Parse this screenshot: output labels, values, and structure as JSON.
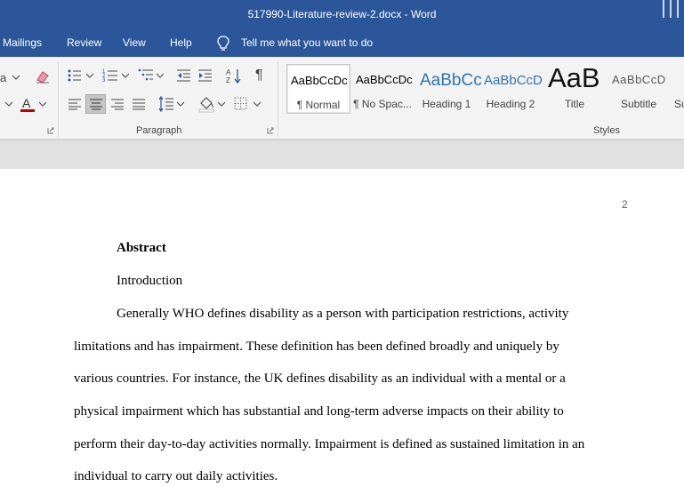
{
  "window": {
    "title": "517990-Literature-review-2.docx  -  Word"
  },
  "menu": {
    "tabs": [
      "Mailings",
      "Review",
      "View",
      "Help"
    ],
    "tell_me": "Tell me what you want to do"
  },
  "ribbon": {
    "groups": {
      "paragraph": "Paragraph",
      "styles": "Styles"
    },
    "styles": [
      {
        "preview": "AaBbCcDc",
        "name": "¶ Normal"
      },
      {
        "preview": "AaBbCcDc",
        "name": "¶ No Spac..."
      },
      {
        "preview": "AaBbCc",
        "name": "Heading 1"
      },
      {
        "preview": "AaBbCcD",
        "name": "Heading 2"
      },
      {
        "preview": "AaB",
        "name": "Title"
      },
      {
        "preview": "AaBbCcD",
        "name": "Subtitle"
      },
      {
        "preview": "",
        "name": "Su"
      }
    ],
    "colors": {
      "accent": "#2b579a",
      "heading": "#2e74b5",
      "font_color": "#c00000",
      "highlight": "#ffff00"
    }
  },
  "document": {
    "page_number": "2",
    "heading": "Abstract",
    "subheading": "Introduction",
    "lines": [
      "Generally WHO defines disability as a person with participation restrictions, activity",
      "limitations and has impairment. These definition has been defined broadly and uniquely by",
      "various countries. For instance, the UK defines disability as an individual with a mental or a",
      "physical impairment which has substantial and long-term adverse impacts on their ability to",
      "perform their day-to-day activities normally. Impairment is defined as sustained limitation in an",
      "individual to carry out daily activities."
    ]
  }
}
